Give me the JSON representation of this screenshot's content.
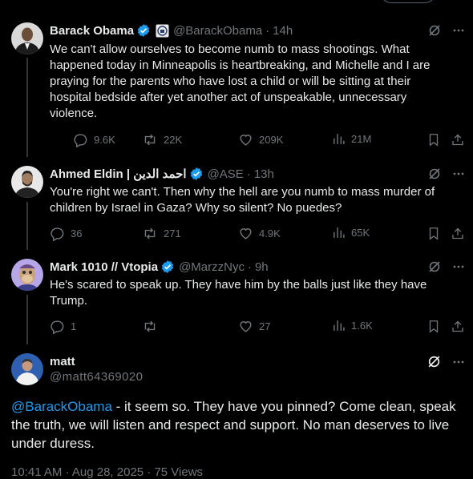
{
  "tweets": [
    {
      "name": "Barack Obama",
      "handle": "@BarackObama",
      "time": "14h",
      "text": "We can't allow ourselves to become numb to mass shootings. What happened today in Minneapolis is heartbreaking, and Michelle and I are praying for the parents who have lost a child or will be sitting at their hospital bedside after yet another act of unspeakable, unnecessary violence.",
      "replies": "9.6K",
      "reposts": "22K",
      "likes": "209K",
      "views": "21M"
    },
    {
      "name": "Ahmed Eldin | احمد الدين",
      "handle": "@ASE",
      "time": "13h",
      "text": "You're right we can't. Then why the hell are you numb to mass murder of children by Israel in Gaza? Why so silent? No puedes?",
      "replies": "36",
      "reposts": "271",
      "likes": "4.9K",
      "views": "65K"
    },
    {
      "name": "Mark 1010 // Vtopia",
      "handle": "@MarzzNyc",
      "time": "9h",
      "text": "He's scared to speak up. They have him by the balls just like they have Trump.",
      "replies": "1",
      "reposts": "",
      "likes": "27",
      "views": "1.6K"
    }
  ],
  "main_post": {
    "name": "matt",
    "handle": "@matt64369020",
    "mention": "@BarackObama",
    "text": " - it seem so.  They have you pinned?  Come clean, speak the truth, we will listen and respect and support.  No man deserves to live under duress.",
    "footer": "10:41 AM · Aug 28, 2025 · 75 Views"
  },
  "colors": {
    "background": "#000000",
    "text": "#e7e9ea",
    "muted": "#71767b",
    "verified": "#1d9bf0",
    "link": "#1d9bf0"
  }
}
